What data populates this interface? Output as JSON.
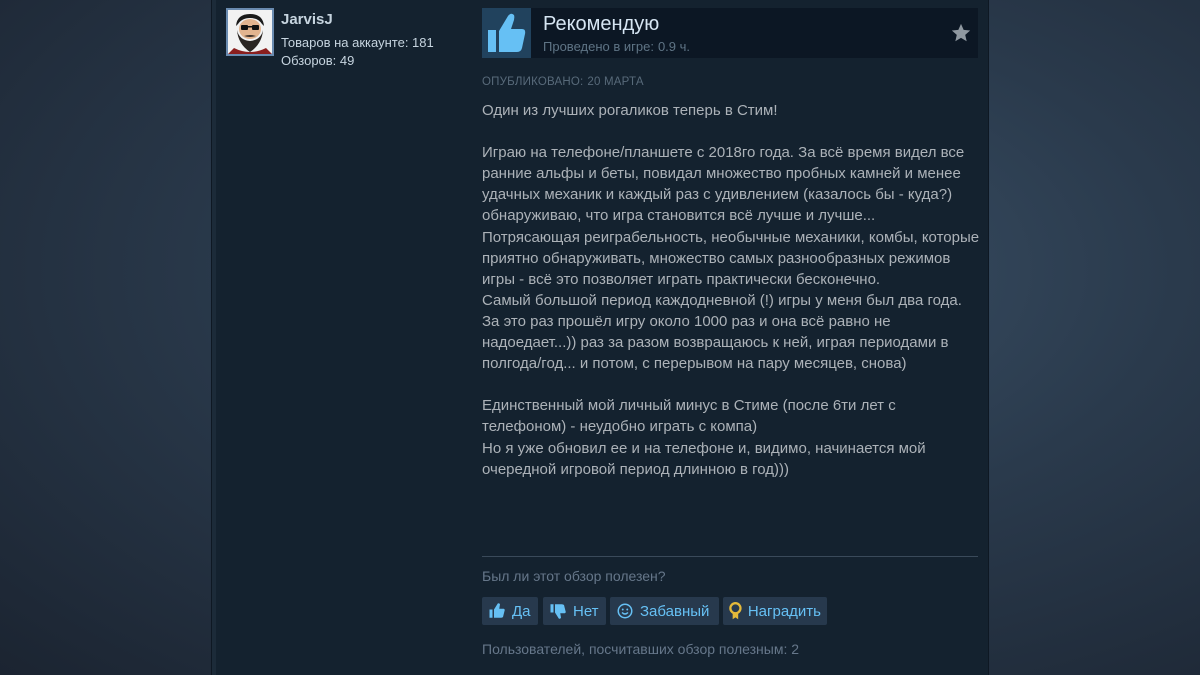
{
  "author": {
    "name": "JarvisJ",
    "products_label": "Товаров на аккаунте: 181",
    "reviews_label": "Обзоров: 49",
    "avatar_icon": "bearded-man-avatar"
  },
  "recommendation": {
    "title": "Рекомендую",
    "hours_label": "Проведено в игре:",
    "hours_value": "0.9 ч.",
    "icon": "thumbs-up-icon",
    "action_icon": "star-icon"
  },
  "review": {
    "posted_label": "Опубликовано:",
    "posted_date": "20 марта",
    "paragraphs": [
      "Один из лучших рогаликов теперь в Стим!",
      "",
      "Играю на телефоне/планшете с 2018го года. За всё время видел все ранние альфы и беты, повидал множество пробных камней и менее удачных механик и каждый раз с удивлением (казалось бы - куда?) обнаруживаю, что игра становится всё лучше и лучше...",
      "Потрясающая реиграбельность, необычные механики, комбы, которые приятно обнаруживать, множество самых разнообразных режимов игры - всё это позволяет играть практически бесконечно.",
      "Самый большой период каждодневной (!) игры у меня был два года. За это раз прошёл игру около 1000 раз и она всё равно не надоедает...)) раз за разом возвращаюсь к ней, играя периодами в полгода/год... и потом, с перерывом на пару месяцев, снова)",
      "",
      "Единственный мой личный минус в Стиме (после 6ти лет с телефоном) - неудобно играть с компа)",
      "Но я уже обновил ее и на телефоне и, видимо, начинается мой очередной игровой период длинною в год)))"
    ]
  },
  "feedback": {
    "question": "Был ли этот обзор полезен?",
    "yes_label": "Да",
    "no_label": "Нет",
    "funny_label": "Забавный",
    "award_label": "Наградить",
    "helpful_count_text": "Пользователей, посчитавших обзор полезным: 2"
  },
  "colors": {
    "accent": "#66c0f4",
    "panel": "#14222f",
    "text": "#acb2b8"
  }
}
